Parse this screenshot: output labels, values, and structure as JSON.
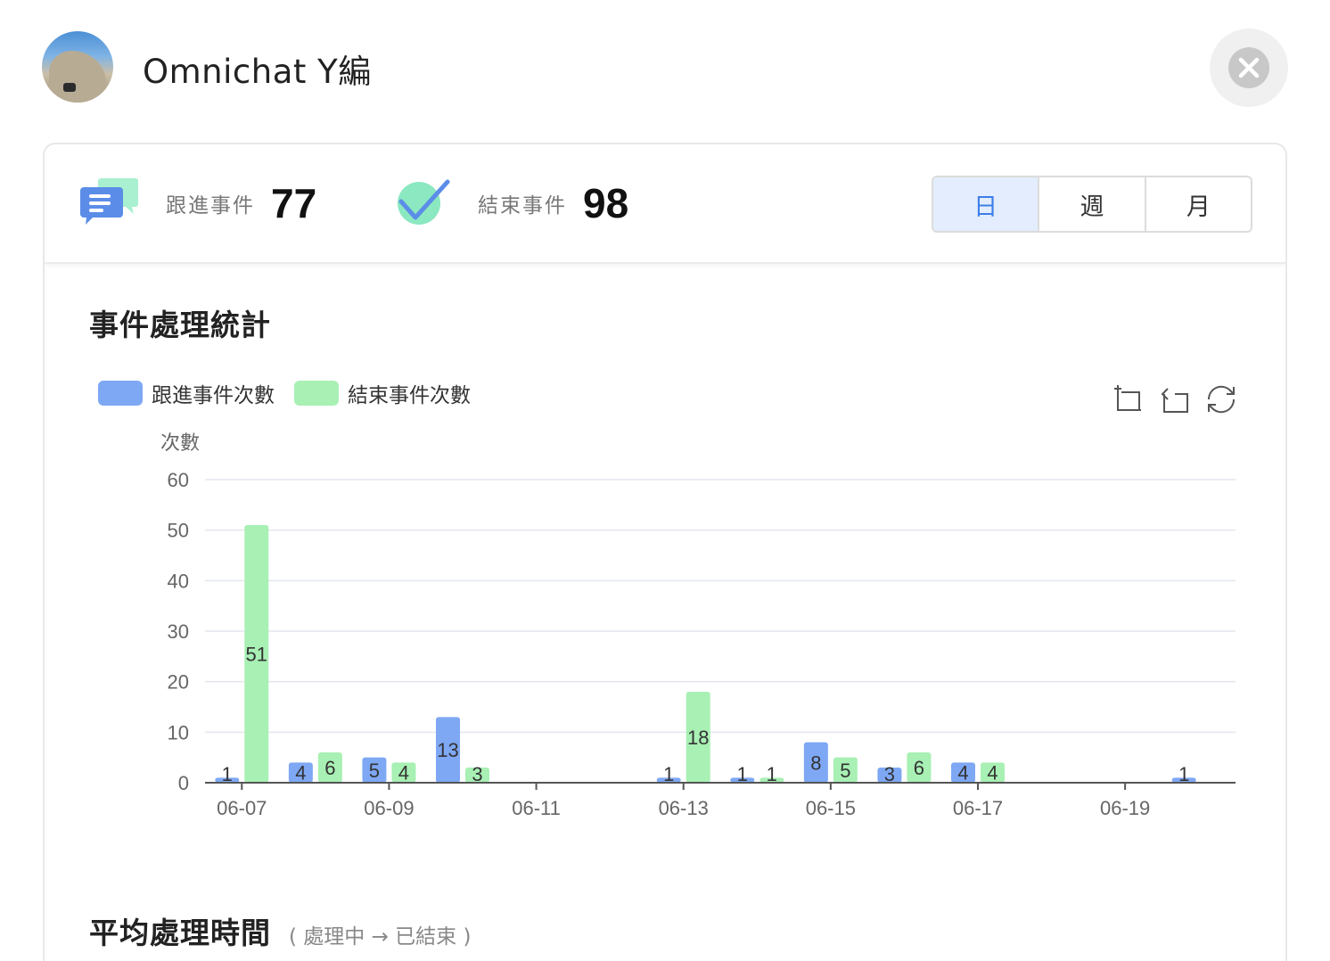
{
  "header": {
    "user_name": "Omnichat Y編"
  },
  "stats": {
    "follow": {
      "label": "跟進事件",
      "value": "77"
    },
    "closed": {
      "label": "結束事件",
      "value": "98"
    }
  },
  "period_toggle": {
    "options": [
      "日",
      "週",
      "月"
    ],
    "selected": "日"
  },
  "sections": {
    "stats_title": "事件處理統計",
    "avg_title": "平均處理時間",
    "avg_subtitle": "( 處理中 → 已結束 )"
  },
  "colors": {
    "follow": "#7ea8f4",
    "closed": "#a8f0b4",
    "accent": "#3d7ee8"
  },
  "chart_data": {
    "type": "bar",
    "ylabel": "次數",
    "xlabel": "",
    "ylim": [
      0,
      60
    ],
    "yticks": [
      0,
      10,
      20,
      30,
      40,
      50,
      60
    ],
    "grid": true,
    "legend_position": "top-left",
    "categories": [
      "06-07",
      "06-08",
      "06-09",
      "06-10",
      "06-11",
      "06-12",
      "06-13",
      "06-14",
      "06-15",
      "06-16",
      "06-17",
      "06-18",
      "06-19",
      "06-20"
    ],
    "x_tick_labels": [
      "06-07",
      "06-09",
      "06-11",
      "06-13",
      "06-15",
      "06-17",
      "06-19"
    ],
    "series": [
      {
        "name": "跟進事件次數",
        "values": [
          1,
          4,
          5,
          13,
          0,
          0,
          1,
          1,
          8,
          3,
          4,
          0,
          0,
          1
        ]
      },
      {
        "name": "結束事件次數",
        "values": [
          51,
          6,
          4,
          3,
          0,
          0,
          18,
          1,
          5,
          6,
          4,
          0,
          0,
          0
        ]
      }
    ]
  }
}
